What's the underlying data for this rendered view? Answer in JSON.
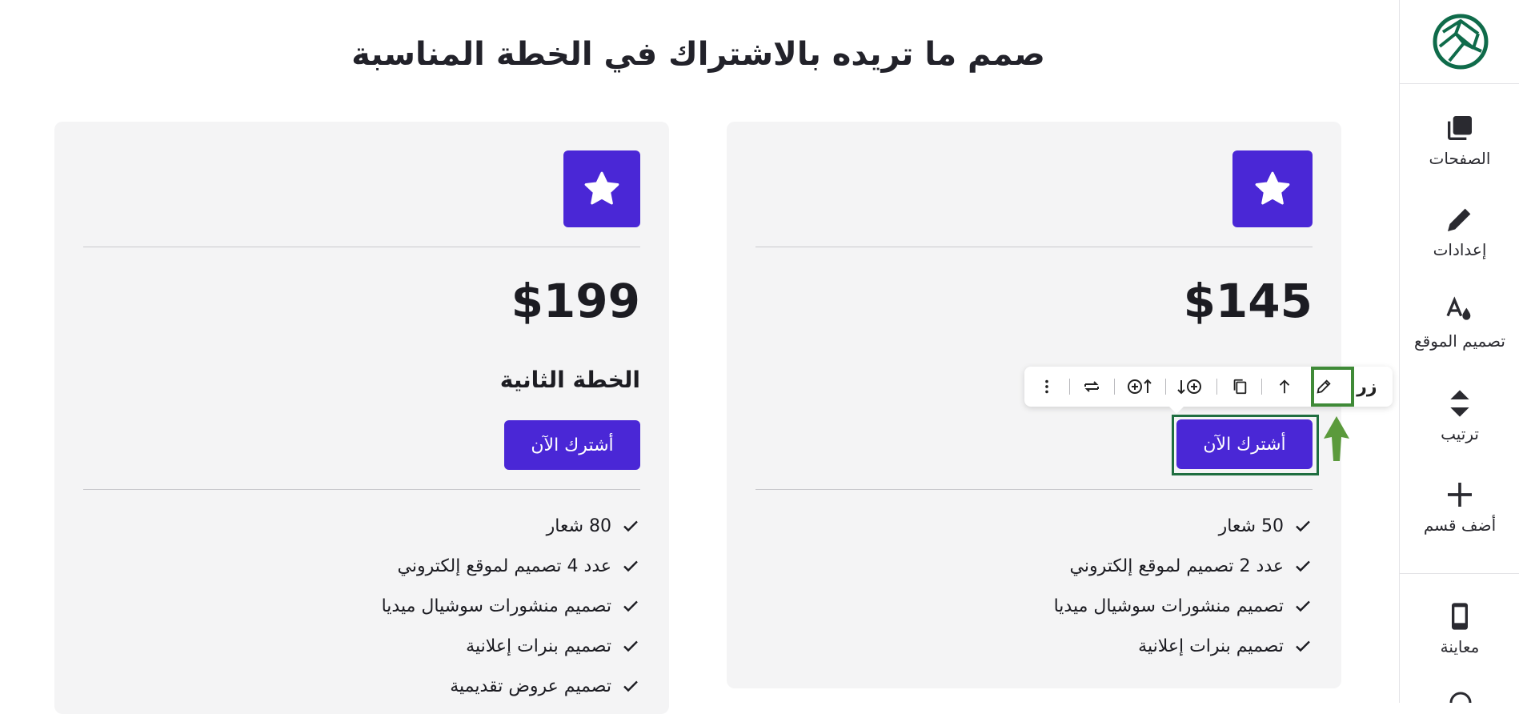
{
  "page": {
    "title": "صمم ما تريده بالاشتراك في الخطة المناسبة"
  },
  "plans": [
    {
      "price": "$145",
      "cta_label": "أشترك الآن",
      "features": [
        "50 شعار",
        "عدد 2 تصميم لموقع إلكتروني",
        "تصميم منشورات سوشيال ميديا",
        "تصميم بنرات إعلانية"
      ]
    },
    {
      "price": "$199",
      "name": "الخطة الثانية",
      "cta_label": "أشترك الآن",
      "features": [
        "80 شعار",
        "عدد 4 تصميم لموقع إلكتروني",
        "تصميم منشورات سوشيال ميديا",
        "تصميم بنرات إعلانية",
        "تصميم عروض تقديمية"
      ]
    }
  ],
  "toolbar": {
    "element_label": "زر",
    "icons": [
      "edit-icon",
      "move-up-icon",
      "duplicate-icon",
      "add-below-icon",
      "add-above-icon",
      "swap-icon",
      "more-icon"
    ]
  },
  "sidebar": {
    "items": [
      {
        "label": "الصفحات",
        "icon": "pages-icon"
      },
      {
        "label": "إعدادات",
        "icon": "pencil-icon"
      },
      {
        "label": "تصميم الموقع",
        "icon": "design-icon"
      },
      {
        "label": "ترتيب",
        "icon": "sort-icon"
      },
      {
        "label": "أضف قسم",
        "icon": "plus-icon"
      },
      {
        "label": "معاينة",
        "icon": "phone-icon"
      }
    ]
  },
  "colors": {
    "accent": "#4a27d6",
    "highlight": "#3f8a37",
    "card_bg": "#f4f4f5"
  }
}
